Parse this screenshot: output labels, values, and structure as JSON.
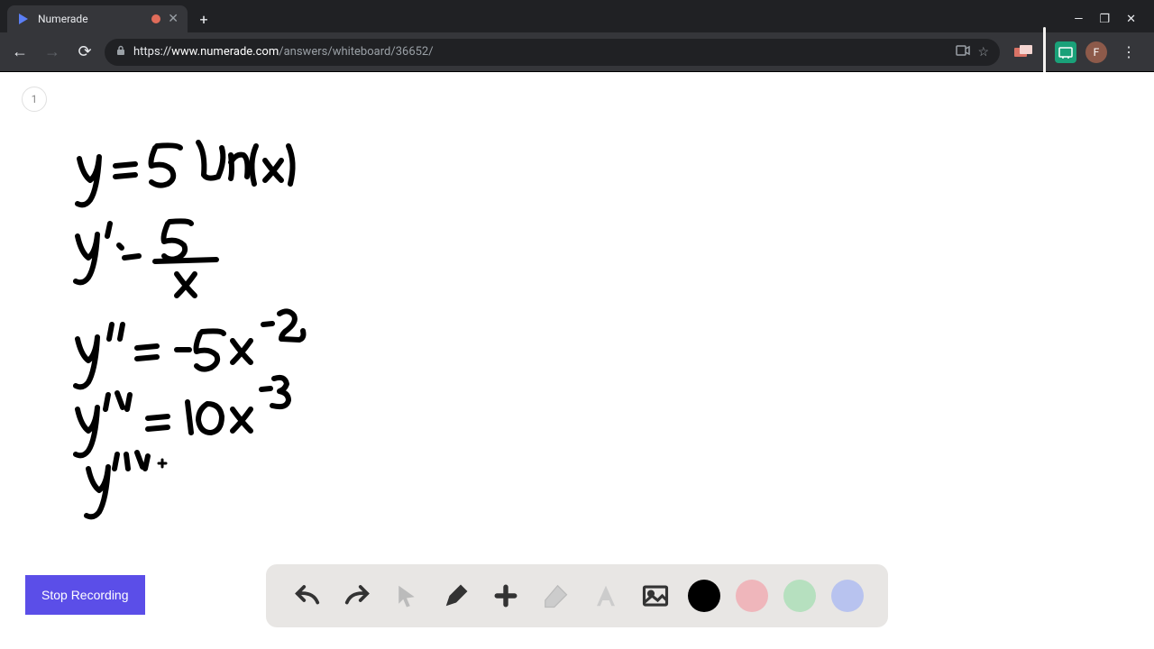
{
  "browser": {
    "tab": {
      "title": "Numerade",
      "close_glyph": "✕"
    },
    "new_tab_glyph": "+",
    "window": {
      "min": "—",
      "max": "❐",
      "close": "✕"
    },
    "nav": {
      "back": "←",
      "forward": "→",
      "reload": "⟳"
    },
    "url": {
      "full": "https://www.numerade.com/answers/whiteboard/36652/",
      "domain": "www.numerade.com",
      "path": "/answers/whiteboard/36652/",
      "scheme": "https://"
    },
    "addr_icons": {
      "video": "▭",
      "star": "☆"
    },
    "avatar_letter": "F",
    "menu": "⋮"
  },
  "page": {
    "counter": "1",
    "stop_recording": "Stop Recording",
    "handwriting_lines": [
      "y = 5 ln(x)",
      "y' = 5 / x",
      "y'' = -5x^{-2}",
      "y''' = 10x^{-3}",
      "y'''' "
    ]
  },
  "toolbar": {
    "undo": "undo",
    "redo": "redo",
    "pointer": "pointer",
    "pen": "pen",
    "plus": "plus",
    "eraser": "eraser",
    "text": "text",
    "image": "image",
    "colors": {
      "black": "#000000",
      "pink": "#efb6bb",
      "green": "#b6e0bf",
      "blue": "#b8c3ef"
    }
  }
}
